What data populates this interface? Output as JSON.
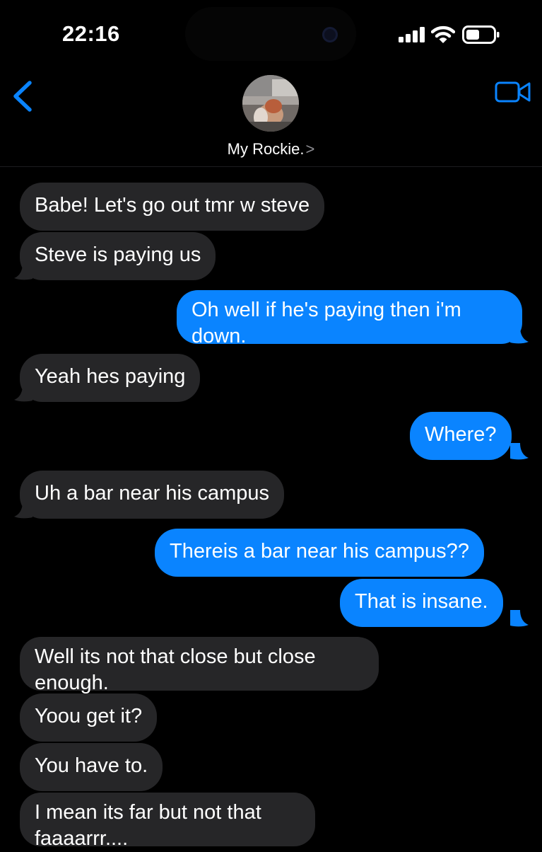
{
  "status_bar": {
    "time": "22:16",
    "icons": [
      "signal-icon",
      "wifi-icon",
      "battery-icon"
    ]
  },
  "header": {
    "contact_name": "My Rockie.",
    "chevron": ">",
    "icons": [
      "back-chevron-icon",
      "video-camera-icon",
      "contact-avatar"
    ]
  },
  "colors": {
    "background": "#000000",
    "received_bubble": "#262628",
    "sent_bubble": "#0a84ff",
    "accent": "#0a84ff"
  },
  "messages": [
    {
      "direction": "received",
      "text": "Babe! Let's go out tmr w steve"
    },
    {
      "direction": "received",
      "text": "Steve is paying us"
    },
    {
      "direction": "sent",
      "lines": [
        "Oh well if he's paying then i'm",
        "down."
      ]
    },
    {
      "direction": "received",
      "text": "Yeah hes paying"
    },
    {
      "direction": "sent",
      "text": "Where?"
    },
    {
      "direction": "received",
      "text": "Uh a bar near his campus"
    },
    {
      "direction": "sent",
      "text": "Thereis a bar near his campus??"
    },
    {
      "direction": "sent",
      "text": "That is insane."
    },
    {
      "direction": "received",
      "lines": [
        "Well its not that close but close",
        "enough."
      ]
    },
    {
      "direction": "received",
      "text": "Yoou get it?"
    },
    {
      "direction": "received",
      "text": "You have to."
    },
    {
      "direction": "received",
      "lines": [
        "I mean its far but not that",
        "faaaarrr...."
      ]
    }
  ]
}
